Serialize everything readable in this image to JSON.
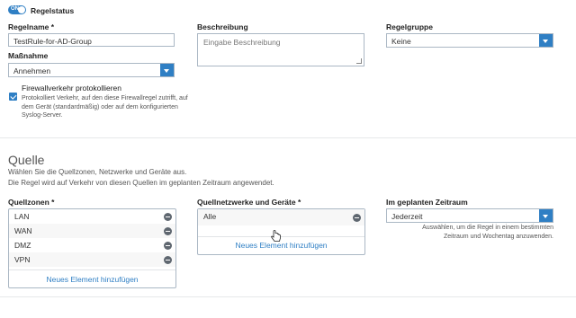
{
  "rule_status": {
    "toggle_text": "ON",
    "label": "Regelstatus"
  },
  "rule_name": {
    "label": "Regelname *",
    "value": "TestRule-for-AD-Group"
  },
  "action": {
    "label": "Maßnahme",
    "selected": "Annehmen"
  },
  "log": {
    "label": "Firewallverkehr protokollieren",
    "help": "Protokolliert Verkehr, auf den diese Firewallregel zutrifft, auf dem Gerät (standardmäßig) oder auf dem konfigurierten Syslog-Server.",
    "checked": true
  },
  "description": {
    "label": "Beschreibung",
    "placeholder": "Eingabe Beschreibung"
  },
  "rule_group": {
    "label": "Regelgruppe",
    "selected": "Keine"
  },
  "source": {
    "title": "Quelle",
    "desc1": "Wählen Sie die Quellzonen, Netzwerke und Geräte aus.",
    "desc2": "Die Regel wird auf Verkehr von diesen Quellen im geplanten Zeitraum angewendet."
  },
  "source_zones": {
    "label": "Quellzonen *",
    "items": [
      "LAN",
      "WAN",
      "DMZ",
      "VPN"
    ],
    "add": "Neues Element hinzufügen"
  },
  "source_networks": {
    "label": "Quellnetzwerke und Geräte *",
    "items": [
      "Alle"
    ],
    "add": "Neues Element hinzufügen"
  },
  "schedule": {
    "label": "Im geplanten Zeitraum",
    "selected": "Jederzeit",
    "help": "Auswählen, um die Regel in einem bestimmten Zeitraum und Wochentag anzuwenden."
  },
  "colors": {
    "accent": "#2f7fc4"
  }
}
